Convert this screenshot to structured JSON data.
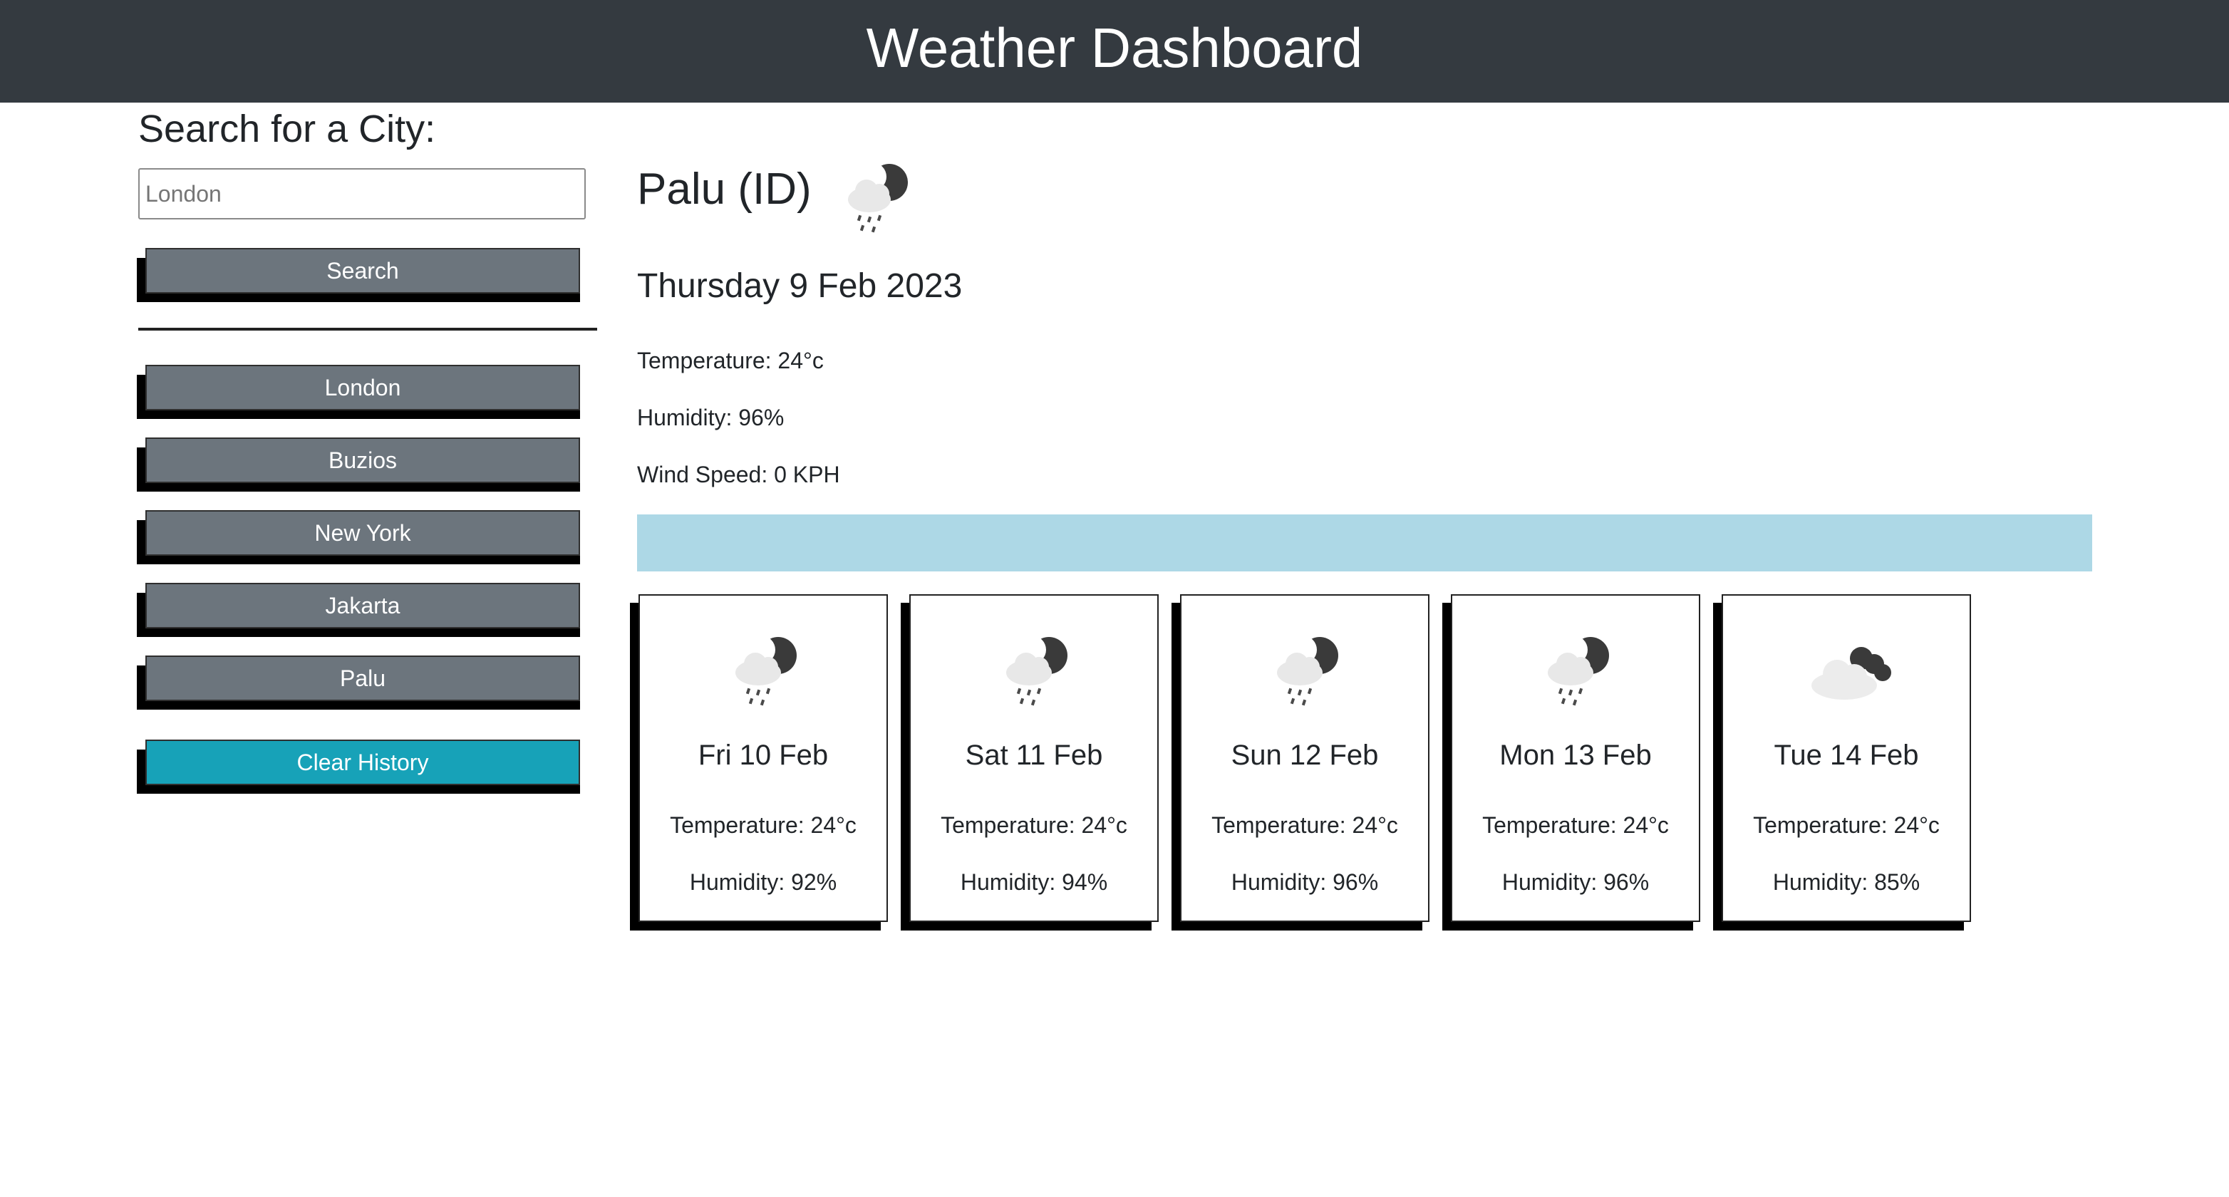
{
  "header": {
    "title": "Weather Dashboard"
  },
  "search": {
    "heading": "Search for a City:",
    "placeholder": "London",
    "button_label": "Search"
  },
  "history": [
    {
      "label": "London"
    },
    {
      "label": "Buzios"
    },
    {
      "label": "New York"
    },
    {
      "label": "Jakarta"
    },
    {
      "label": "Palu"
    }
  ],
  "clear_label": "Clear History",
  "current": {
    "city": "Palu (ID)",
    "icon": "rain-night-icon",
    "date": "Thursday 9 Feb 2023",
    "temperature": "Temperature: 24°c",
    "humidity": "Humidity: 96%",
    "wind": "Wind Speed: 0 KPH"
  },
  "forecast": [
    {
      "date": "Fri 10 Feb",
      "icon": "rain-night-icon",
      "temperature": "Temperature: 24°c",
      "humidity": "Humidity: 92%"
    },
    {
      "date": "Sat 11 Feb",
      "icon": "rain-night-icon",
      "temperature": "Temperature: 24°c",
      "humidity": "Humidity: 94%"
    },
    {
      "date": "Sun 12 Feb",
      "icon": "rain-night-icon",
      "temperature": "Temperature: 24°c",
      "humidity": "Humidity: 96%"
    },
    {
      "date": "Mon 13 Feb",
      "icon": "rain-night-icon",
      "temperature": "Temperature: 24°c",
      "humidity": "Humidity: 96%"
    },
    {
      "date": "Tue 14 Feb",
      "icon": "broken-clouds-icon",
      "temperature": "Temperature: 24°c",
      "humidity": "Humidity: 85%"
    }
  ],
  "colors": {
    "header_bg": "#343a40",
    "button_bg": "#6c757d",
    "clear_bg": "#17a2b8",
    "band_bg": "#add8e6"
  }
}
